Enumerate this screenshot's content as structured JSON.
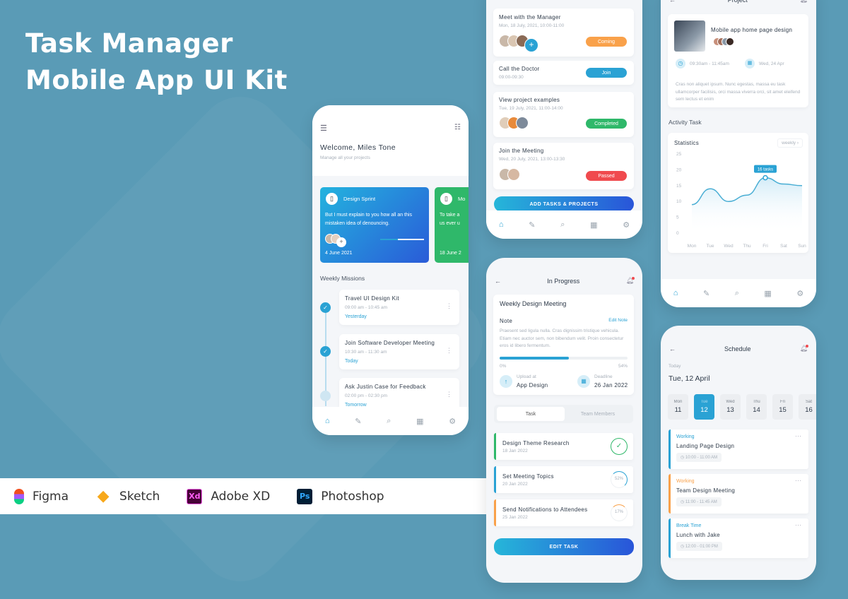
{
  "hero": {
    "line1": "Task Manager",
    "line2": "Mobile App UI Kit"
  },
  "tools": [
    {
      "name": "Figma",
      "icon": "figma-icon",
      "glyph": "✦",
      "color": "#f24e1e"
    },
    {
      "name": "Sketch",
      "icon": "sketch-icon",
      "glyph": "◆",
      "color": "#f7a81b"
    },
    {
      "name": "Adobe XD",
      "icon": "adobe-xd-icon",
      "glyph": "Xd",
      "color": "#ff61f6"
    },
    {
      "name": "Photoshop",
      "icon": "photoshop-icon",
      "glyph": "Ps",
      "color": "#31a8ff"
    }
  ],
  "home": {
    "welcome": "Welcome, Miles Tone",
    "subtitle": "Manage all your projects",
    "projects": [
      {
        "title": "Design Sprint",
        "desc": "But I must explain to you how all an this mistaken idea of denouncing.",
        "date": "4 June 2021",
        "progress": 0.4
      },
      {
        "title": "Mo",
        "desc": "To take a us ever u",
        "date": "18 June 2"
      }
    ],
    "missions_title": "Weekly Missions",
    "missions": [
      {
        "title": "Travel UI Design Kit",
        "time": "09:00 am - 10:45 am",
        "day": "Yesterday",
        "done": true
      },
      {
        "title": "Join Software Developer Meeting",
        "time": "10:30 am - 11:30 am",
        "day": "Today",
        "done": true
      },
      {
        "title": "Ask Justin Case for Feedback",
        "time": "02:00 pm - 02:30 pm",
        "day": "Tomorrow",
        "done": false
      }
    ]
  },
  "meetings": {
    "items": [
      {
        "title": "Meet with the Manager",
        "time": "Mon, 18 July, 2021, 10:00-11:00",
        "status": "Coming",
        "color": "#f9a14a"
      },
      {
        "title": "Call the Doctor",
        "time": "09:00-09:30",
        "status": "Join",
        "color": "#2aa2d4"
      },
      {
        "title": "View project examples",
        "time": "Tue, 19 July, 2021, 11:00-14:00",
        "status": "Completed",
        "color": "#2fb86a"
      },
      {
        "title": "Join the Meeting",
        "time": "Wed, 20 July, 2021, 13:00-13:30",
        "status": "Passed",
        "color": "#f04a4e"
      }
    ],
    "add_button": "ADD TASKS & PROJECTS"
  },
  "project": {
    "header": "Project",
    "title": "Mobile app home page design",
    "time": "09:30am - 11:45am",
    "date": "Wed, 24 Apr",
    "desc": "Cras non aliquet ipsum. Nunc egestas, massa eu task ullamcorper facilisis, orci massa viverra orci, sit amet eleifend sem lectus et enim",
    "activity_title": "Activity Task",
    "stats_title": "Statistics",
    "period": "weekly",
    "tooltip": "16 tasks"
  },
  "chart_data": {
    "type": "line",
    "title": "Statistics",
    "categories": [
      "Mon",
      "Tue",
      "Wed",
      "Thu",
      "Fri",
      "Sat",
      "Sun"
    ],
    "values": [
      9,
      14,
      10,
      12,
      17.5,
      15.5,
      15
    ],
    "yticks": [
      0,
      5,
      10,
      15,
      20,
      25
    ],
    "ylim": [
      0,
      25
    ],
    "highlight": {
      "category": "Fri",
      "label": "16 tasks"
    }
  },
  "inprogress": {
    "header": "In Progress",
    "title": "Weekly Design Meeting",
    "note_label": "Note",
    "edit_note": "Edit Note",
    "note": "Praesent sed ligula nulla. Cras dignissim tristique vehicula. Etiam nec auctor sem, non bibendum velit. Proin consectetur eros id libero fermentum.",
    "progress": 0.54,
    "progress_start": "0%",
    "progress_end": "54%",
    "upload_label": "Upload at",
    "upload_value": "App Design",
    "deadline_label": "Deadline",
    "deadline_value": "26 Jan 2022",
    "tabs": [
      "Task",
      "Team Members"
    ],
    "tasks": [
      {
        "title": "Design Theme Research",
        "date": "18 Jan 2022",
        "pct": "✓",
        "color": "#2fb86a"
      },
      {
        "title": "Set Meeting Topics",
        "date": "20 Jan 2022",
        "pct": "52%",
        "color": "#2aa2d4"
      },
      {
        "title": "Send Notifications to Attendees",
        "date": "25 Jan 2022",
        "pct": "17%",
        "color": "#f9a14a"
      }
    ],
    "edit_button": "EDIT TASK"
  },
  "schedule": {
    "header": "Schedule",
    "today_label": "Today",
    "today_date": "Tue, 12 April",
    "days": [
      {
        "d": "Mon",
        "n": "11"
      },
      {
        "d": "Tue",
        "n": "12",
        "active": true
      },
      {
        "d": "Wed",
        "n": "13"
      },
      {
        "d": "Thu",
        "n": "14"
      },
      {
        "d": "Fri",
        "n": "15"
      },
      {
        "d": "Sat",
        "n": "16"
      }
    ],
    "items": [
      {
        "status": "Working",
        "title": "Landing Page Design",
        "time": "10:00 - 11:00 AM",
        "color": "#2aa2d4"
      },
      {
        "status": "Working",
        "title": "Team Design Meeting",
        "time": "11:00 - 11:45 AM",
        "color": "#f9a14a"
      },
      {
        "status": "Break Time",
        "title": "Lunch with Jake",
        "time": "12:00 - 01:00 PM",
        "color": "#2aa2d4"
      }
    ]
  },
  "nav": [
    "⌂",
    "✎",
    "⌕",
    "▦",
    "⚙"
  ]
}
